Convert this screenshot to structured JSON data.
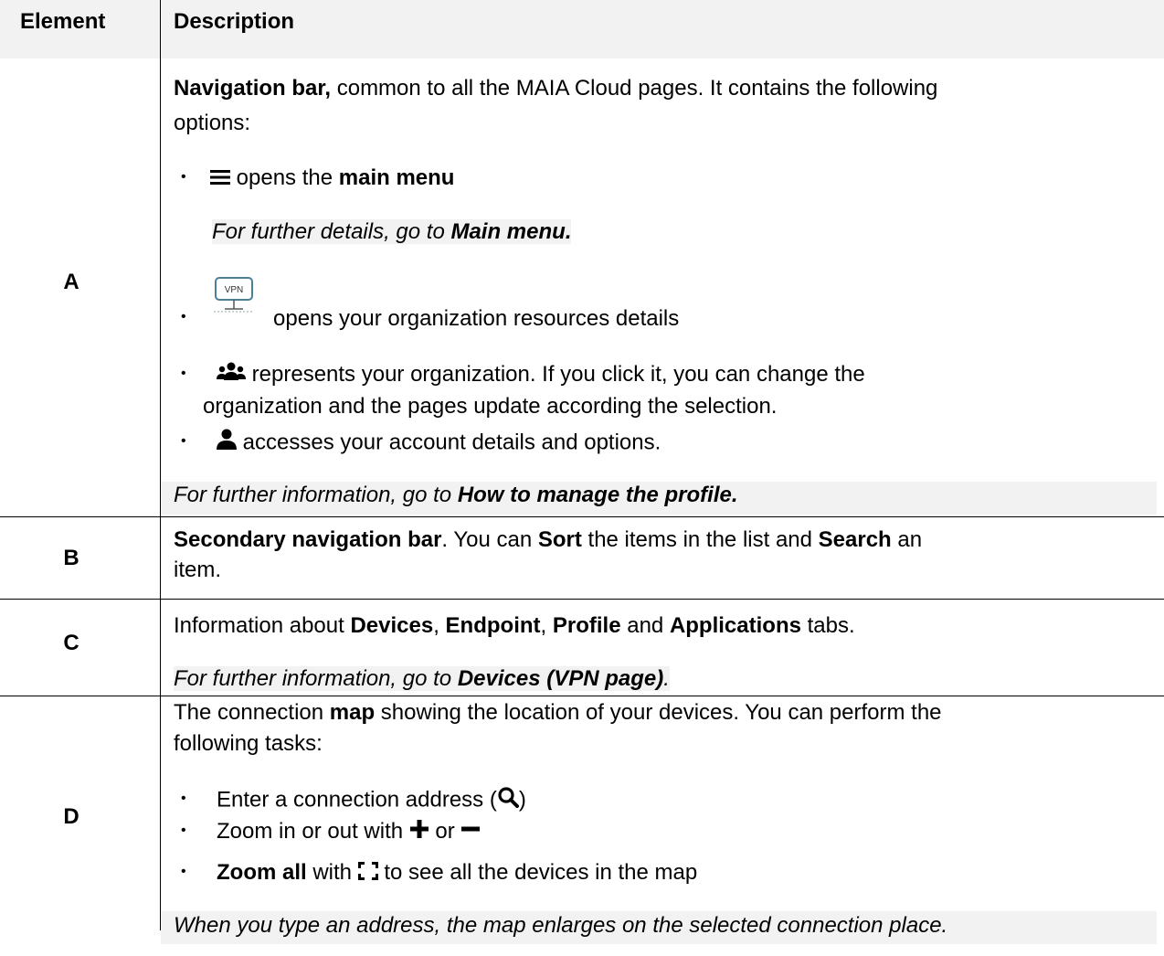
{
  "header": {
    "col_element": "Element",
    "col_description": "Description"
  },
  "rows": {
    "a": {
      "letter": "A",
      "intro_bold": "Navigation bar,",
      "intro_rest_1": " common to all the MAIA Cloud pages. It contains the following",
      "intro_rest_2": "options:",
      "b1_text": " opens the ",
      "b1_bold": "main menu",
      "note1_prefix": "For further details, go to ",
      "note1_bold": "Main menu.",
      "vpn_icon_label": "VPN",
      "b2_text": "opens your organization resources details",
      "b3_text_1": " represents your organization. If you click it, you can change the",
      "b3_text_2": "organization and the pages update according the selection.",
      "b4_text": " accesses your account details and options.",
      "note2_prefix": "For further information, go to ",
      "note2_bold": "How to manage the profile."
    },
    "b": {
      "letter": "B",
      "t1_bold": "Secondary navigation bar",
      "t1": ". You can ",
      "t2_bold": "Sort",
      "t2": " the items in the list and ",
      "t3_bold": "Search",
      "t3": " an",
      "line2": "item."
    },
    "c": {
      "letter": "C",
      "t1": "Information about ",
      "devices": "Devices",
      "comma": ", ",
      "endpoint": "Endpoint",
      "comma2": ", ",
      "profile": "Profile",
      "and": " and ",
      "applications": "Applications",
      "tabs": " tabs.",
      "note_prefix": "For further information, go to ",
      "note_bold": "Devices (VPN page)",
      "note_end": "."
    },
    "d": {
      "letter": "D",
      "intro_1a": "The connection ",
      "intro_1b_bold": "map",
      "intro_1c": " showing the location of your devices. You can perform the",
      "intro_2": "following tasks:",
      "b1_a": "Enter a connection address (",
      "b1_b": ")",
      "b2_a": "Zoom in or out with ",
      "b2_b": " or ",
      "b3_bold": "Zoom all",
      "b3_a": " with ",
      "b3_b": " to see all the devices in the map",
      "note": "When you type an address, the map enlarges on the selected connection place."
    }
  },
  "bullet_char": "•"
}
